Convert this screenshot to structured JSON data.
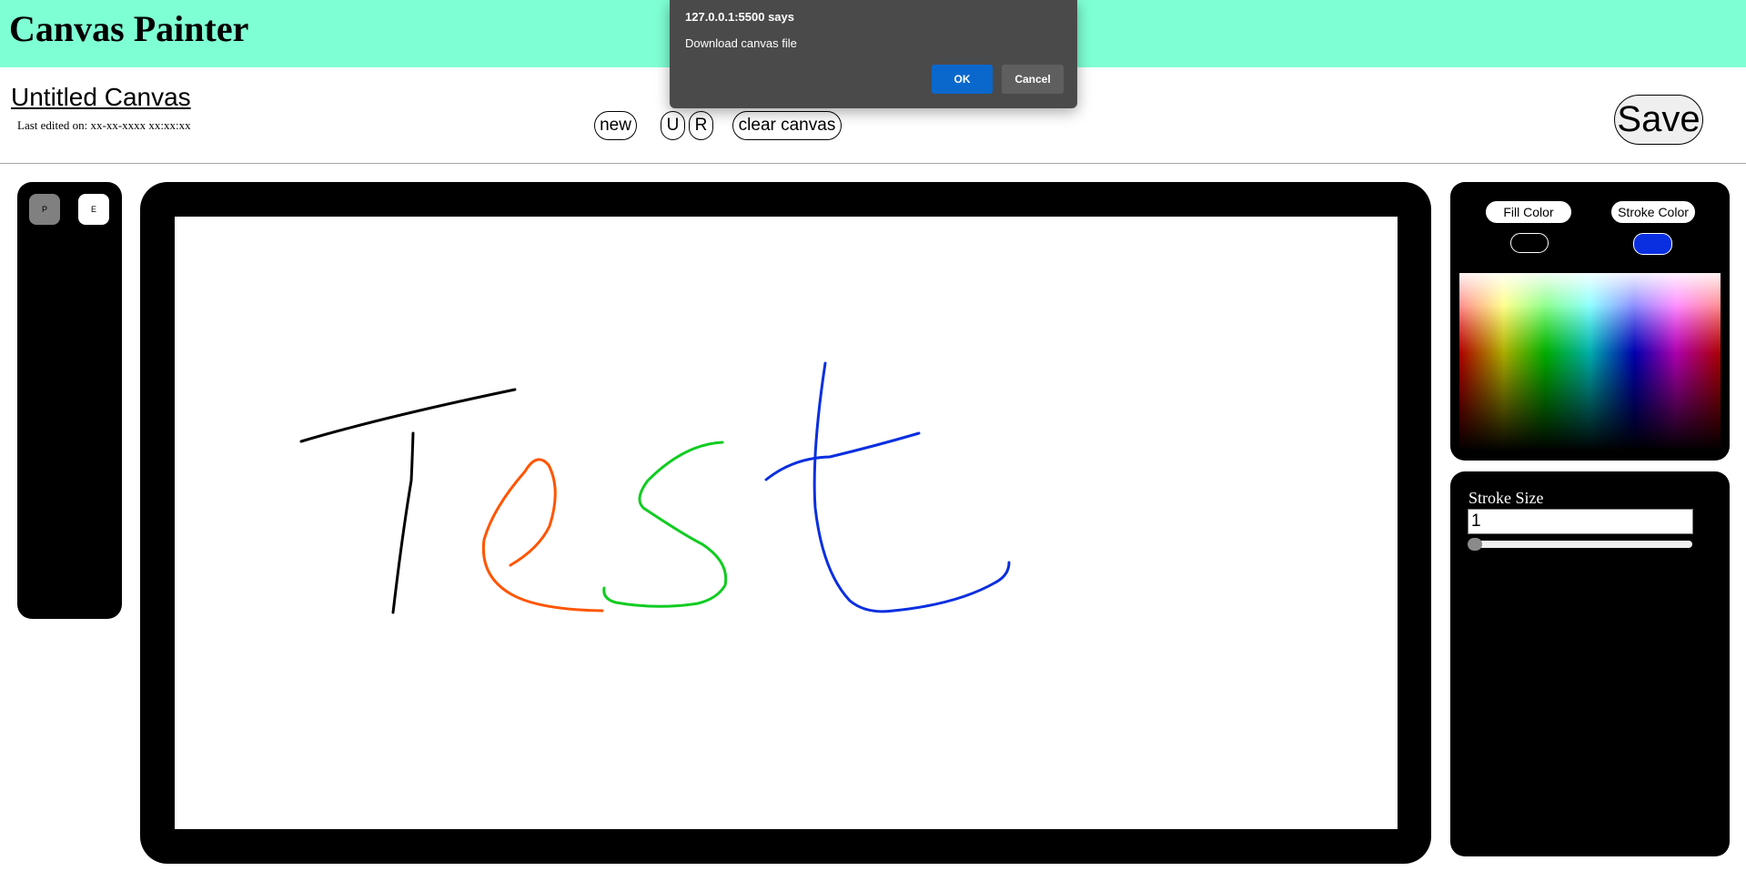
{
  "app": {
    "title": "Canvas Painter"
  },
  "document": {
    "name": "Untitled Canvas",
    "last_edited": "Last edited on: xx-xx-xxxx xx:xx:xx"
  },
  "toolbar": {
    "new_label": "new",
    "undo_label": "U",
    "redo_label": "R",
    "clear_label": "clear canvas",
    "save_label": "Save"
  },
  "tools": {
    "pen_label": "P",
    "eraser_label": "E",
    "active": "pen"
  },
  "colors": {
    "fill_label": "Fill Color",
    "stroke_label": "Stroke Color",
    "fill_value": "#000000",
    "stroke_value": "#0a2fe0",
    "header_bg": "#7fffd4"
  },
  "stroke": {
    "label": "Stroke Size",
    "value": "1"
  },
  "canvas": {
    "drawn_text": "Test",
    "stroke_colors": [
      "#000000",
      "#ff5500",
      "#11cc22",
      "#0a2fe0"
    ]
  },
  "dialog": {
    "title": "127.0.0.1:5500 says",
    "message": "Download canvas file",
    "ok_label": "OK",
    "cancel_label": "Cancel"
  }
}
